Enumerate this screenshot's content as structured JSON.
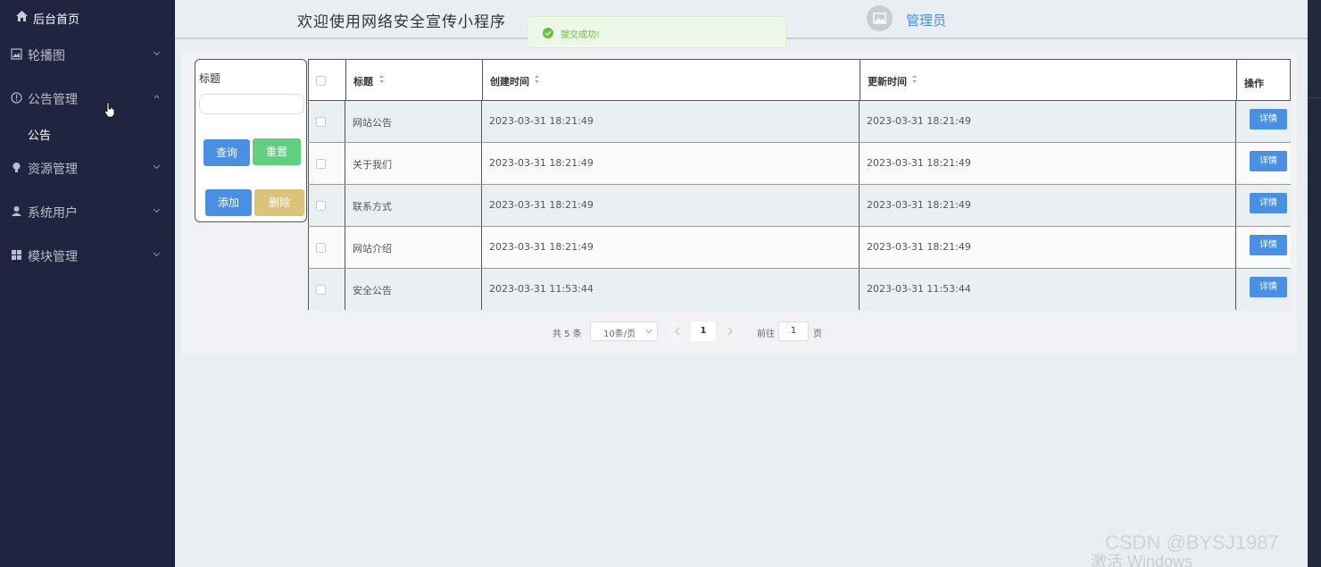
{
  "sidebar": {
    "home_label": "后台首页",
    "items": [
      {
        "label": "轮播图",
        "icon": "picture-icon"
      },
      {
        "label": "公告管理",
        "icon": "info-circle-icon"
      },
      {
        "label": "资源管理",
        "icon": "lightbulb-icon"
      },
      {
        "label": "系统用户",
        "icon": "user-icon"
      },
      {
        "label": "模块管理",
        "icon": "grid-icon"
      }
    ],
    "submenu_label": "公告"
  },
  "header": {
    "welcome": "欢迎使用网络安全宣传小程序",
    "admin_name": "管理员"
  },
  "toast": {
    "text": "提交成功!"
  },
  "search": {
    "title_label": "标题",
    "input_value": "",
    "query_label": "查询",
    "reset_label": "重置",
    "add_label": "添加",
    "delete_label": "删除"
  },
  "table": {
    "columns": [
      "标题",
      "创建时间",
      "更新时间",
      "操作"
    ],
    "rows": [
      {
        "title": "网站公告",
        "created": "2023-03-31 18:21:49",
        "updated": "2023-03-31 18:21:49",
        "action": "详情"
      },
      {
        "title": "关于我们",
        "created": "2023-03-31 18:21:49",
        "updated": "2023-03-31 18:21:49",
        "action": "详情"
      },
      {
        "title": "联系方式",
        "created": "2023-03-31 18:21:49",
        "updated": "2023-03-31 18:21:49",
        "action": "详情"
      },
      {
        "title": "网站介绍",
        "created": "2023-03-31 18:21:49",
        "updated": "2023-03-31 18:21:49",
        "action": "详情"
      },
      {
        "title": "安全公告",
        "created": "2023-03-31 11:53:44",
        "updated": "2023-03-31 11:53:44",
        "action": "详情"
      }
    ]
  },
  "pagination": {
    "total": "共 5 条",
    "page_size": "10条/页",
    "current_page": "1",
    "goto_label": "前往",
    "goto_value": "1",
    "page_suffix": "页"
  },
  "watermarks": {
    "csdn": "CSDN @BYSJ1987",
    "windows": "激活 Windows"
  },
  "colors": {
    "sidebar_bg": "#1f2540",
    "main_bg": "#e9eef3",
    "primary": "#4a90e2",
    "success": "#5fcf80",
    "warning": "#dcc27a"
  }
}
